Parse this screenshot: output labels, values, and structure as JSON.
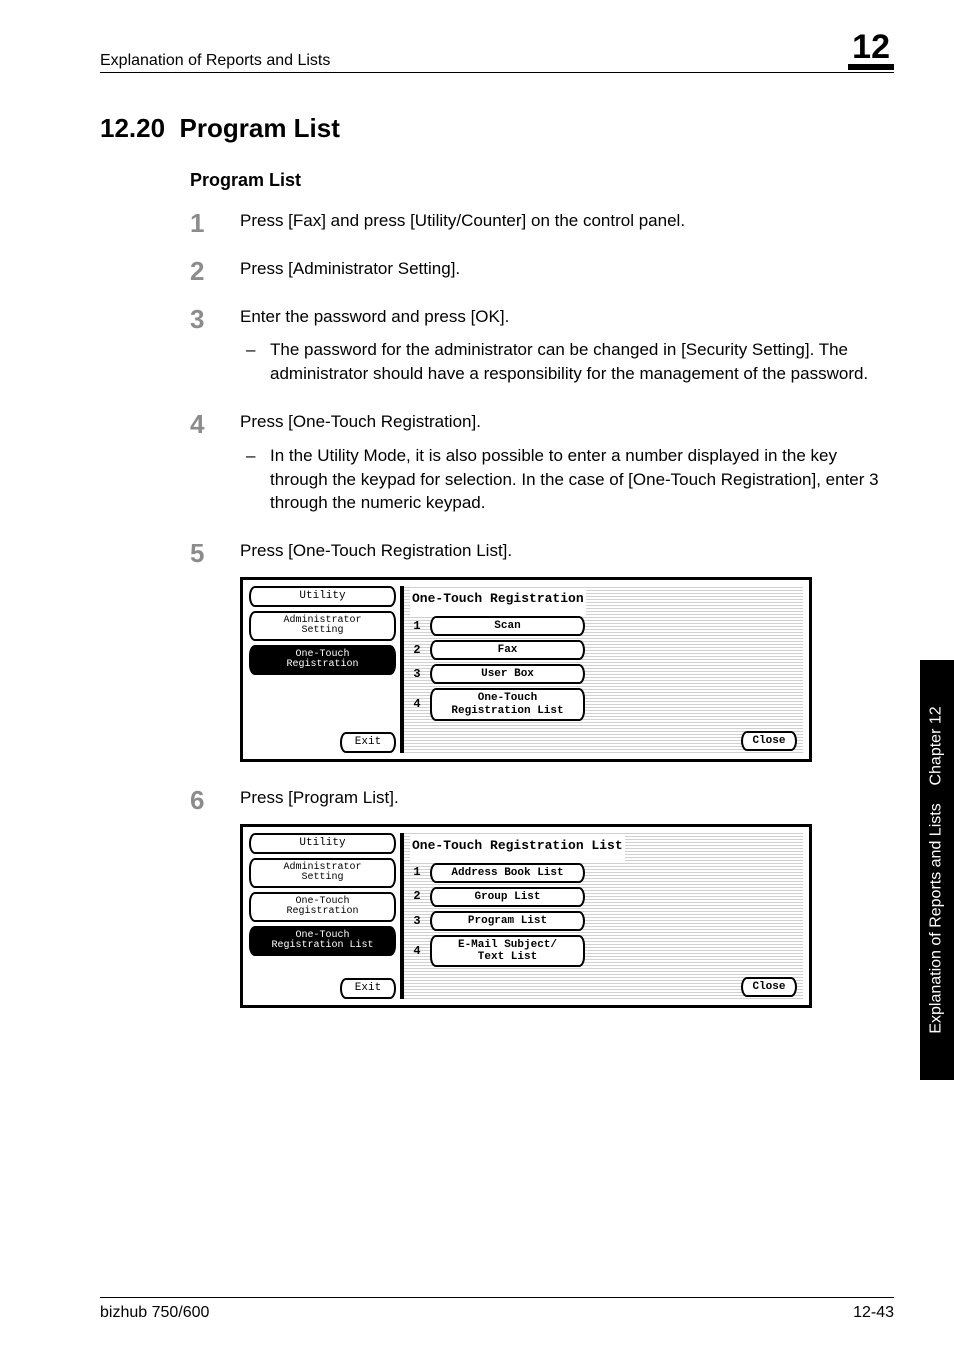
{
  "header": {
    "running_title": "Explanation of Reports and Lists",
    "chapter_number": "12"
  },
  "section": {
    "number": "12.20",
    "title": "Program List",
    "subsection_title": "Program List"
  },
  "steps": [
    {
      "text": "Press [Fax] and press [Utility/Counter] on the control panel."
    },
    {
      "text": "Press [Administrator Setting]."
    },
    {
      "text": "Enter the password and press [OK].",
      "sub": "The password for the administrator can be changed in [Security Setting]. The administrator should have a responsibility for the management of the password."
    },
    {
      "text": "Press [One-Touch Registration].",
      "sub": "In the Utility Mode, it is also possible to enter a number displayed in the key through the keypad for selection. In the case of [One-Touch Registration], enter 3 through the numeric keypad."
    },
    {
      "text": "Press [One-Touch Registration List]."
    },
    {
      "text": "Press [Program List]."
    }
  ],
  "panel1": {
    "left": {
      "utility": "Utility",
      "admin": "Administrator\nSetting",
      "one_touch": "One-Touch\nRegistration",
      "exit": "Exit"
    },
    "title": "One-Touch Registration",
    "items": [
      {
        "n": "1",
        "label": "Scan"
      },
      {
        "n": "2",
        "label": "Fax"
      },
      {
        "n": "3",
        "label": "User Box"
      },
      {
        "n": "4",
        "label": "One-Touch\nRegistration List"
      }
    ],
    "close": "Close"
  },
  "panel2": {
    "left": {
      "utility": "Utility",
      "admin": "Administrator\nSetting",
      "one_touch": "One-Touch\nRegistration",
      "one_touch_list": "One-Touch\nRegistration List",
      "exit": "Exit"
    },
    "title": "One-Touch Registration List",
    "items": [
      {
        "n": "1",
        "label": "Address Book List"
      },
      {
        "n": "2",
        "label": "Group List"
      },
      {
        "n": "3",
        "label": "Program List"
      },
      {
        "n": "4",
        "label": "E-Mail Subject/\nText List"
      }
    ],
    "close": "Close"
  },
  "side_tab": {
    "chapter": "Chapter 12",
    "section": "Explanation of Reports and Lists"
  },
  "footer": {
    "left": "bizhub 750/600",
    "right": "12-43"
  }
}
